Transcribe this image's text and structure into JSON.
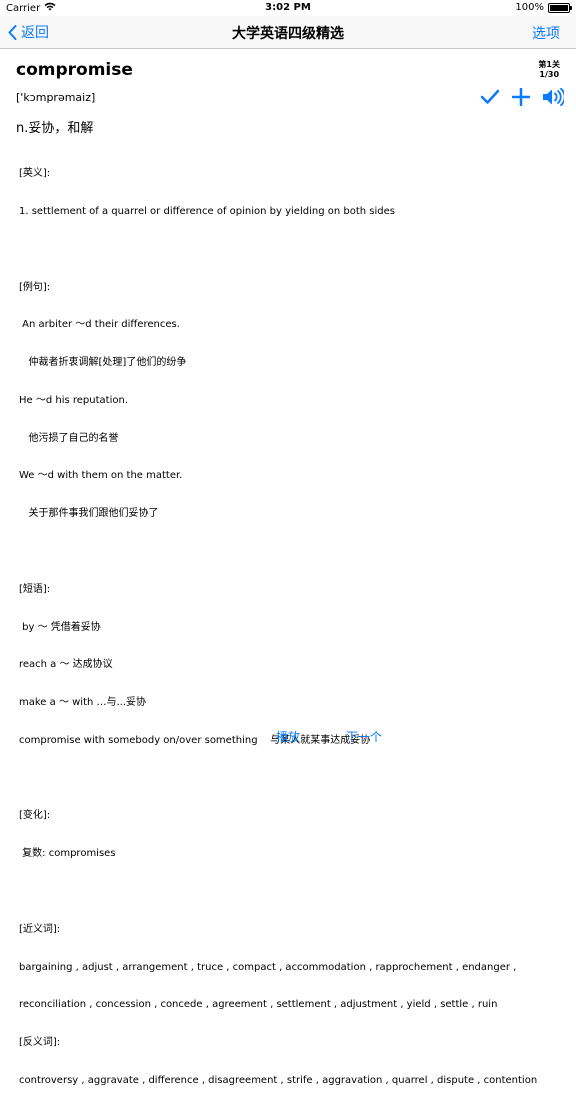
{
  "status_bar": {
    "carrier": "Carrier",
    "time": "3:02 PM",
    "battery": "100%",
    "battery_level": 1.0
  },
  "nav": {
    "back_label": "返回",
    "title": "大学英语四级精选",
    "options_label": "选项"
  },
  "word": {
    "headword": "compromise",
    "level_line1": "第1关",
    "level_line2": "1/30",
    "phonetic": "['kɔmprəmaiz]",
    "short_definition": "n.妥协，和解"
  },
  "icons": {
    "check": "checkmark-icon",
    "add": "plus-icon",
    "speaker": "speaker-icon"
  },
  "content_lines": [
    "[英义]:",
    "1. settlement of a quarrel or difference of opinion by yielding on both sides",
    "",
    "[例句]:",
    " An arbiter ～d their differences.",
    "   仲裁者折衷调解[处理]了他们的纷争",
    "He ～d his reputation.",
    "   他污损了自己的名誉",
    "We ～d with them on the matter.",
    "   关于那件事我们跟他们妥协了",
    "",
    "[短语]:",
    " by ～ 凭借着妥协",
    "reach a ～ 达成协议",
    "make a ～ with …与...妥协",
    "compromise with somebody on/over something    与某人就某事达成妥协",
    "",
    "[变化]:",
    " 复数: compromises",
    "",
    "[近义词]:",
    "bargaining , adjust , arrangement , truce , compact , accommodation , rapprochement , endanger ,",
    "reconciliation , concession , concede , agreement , settlement , adjustment , yield , settle , ruin",
    "[反义词]:",
    "controversy , aggravate , difference , disagreement , strife , aggravation , quarrel , dispute , contention"
  ],
  "bottom": {
    "play_label": "播放",
    "next_label": "下一个"
  },
  "colors": {
    "accent": "#0a7aff",
    "nav_border": "#c8c8cc"
  }
}
